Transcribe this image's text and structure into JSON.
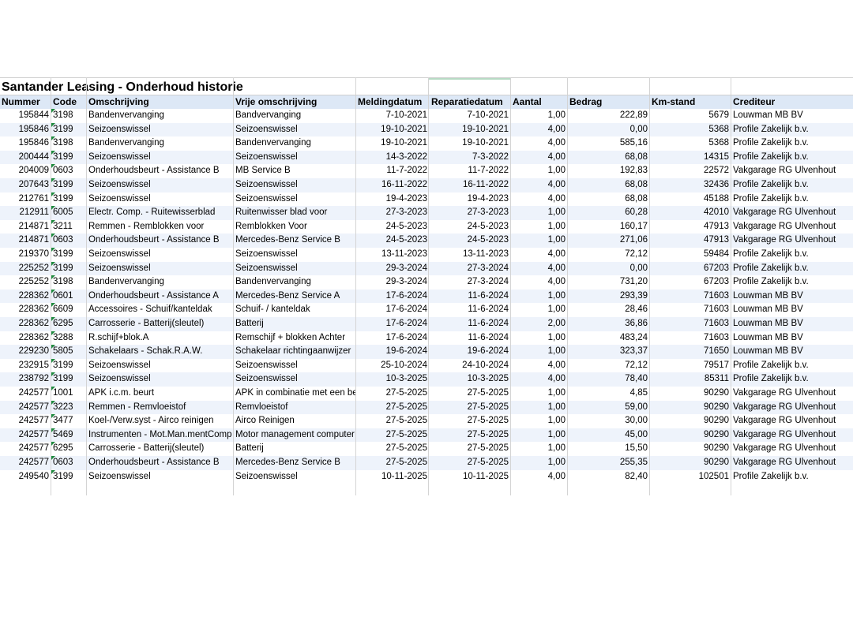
{
  "title": "Santander Leasing - Onderhoud historie",
  "columns": [
    "Nummer",
    "Code",
    "Omschrijving",
    "Vrije omschrijving",
    "Meldingdatum",
    "Reparatiedatum",
    "Aantal",
    "Bedrag",
    "Km-stand",
    "Crediteur"
  ],
  "rows": [
    [
      "195844",
      "3198",
      "Bandenvervanging",
      "Bandvervanging",
      "7-10-2021",
      "7-10-2021",
      "1,00",
      "222,89",
      "5679",
      "Louwman MB BV"
    ],
    [
      "195846",
      "3199",
      "Seizoenswissel",
      "Seizoenswissel",
      "19-10-2021",
      "19-10-2021",
      "4,00",
      "0,00",
      "5368",
      "Profile Zakelijk b.v."
    ],
    [
      "195846",
      "3198",
      "Bandenvervanging",
      "Bandenvervanging",
      "19-10-2021",
      "19-10-2021",
      "4,00",
      "585,16",
      "5368",
      "Profile Zakelijk b.v."
    ],
    [
      "200444",
      "3199",
      "Seizoenswissel",
      "Seizoenswissel",
      "14-3-2022",
      "7-3-2022",
      "4,00",
      "68,08",
      "14315",
      "Profile Zakelijk b.v."
    ],
    [
      "204009",
      "0603",
      "Onderhoudsbeurt - Assistance B",
      "MB Service B",
      "11-7-2022",
      "11-7-2022",
      "1,00",
      "192,83",
      "22572",
      "Vakgarage RG Ulvenhout"
    ],
    [
      "207643",
      "3199",
      "Seizoenswissel",
      "Seizoenswissel",
      "16-11-2022",
      "16-11-2022",
      "4,00",
      "68,08",
      "32436",
      "Profile Zakelijk b.v."
    ],
    [
      "212761",
      "3199",
      "Seizoenswissel",
      "Seizoenswissel",
      "19-4-2023",
      "19-4-2023",
      "4,00",
      "68,08",
      "45188",
      "Profile Zakelijk b.v."
    ],
    [
      "212911",
      "6005",
      "Electr. Comp. - Ruitewisserblad",
      "Ruitenwisser blad voor",
      "27-3-2023",
      "27-3-2023",
      "1,00",
      "60,28",
      "42010",
      "Vakgarage RG Ulvenhout"
    ],
    [
      "214871",
      "3211",
      "Remmen - Remblokken voor",
      "Remblokken Voor",
      "24-5-2023",
      "24-5-2023",
      "1,00",
      "160,17",
      "47913",
      "Vakgarage RG Ulvenhout"
    ],
    [
      "214871",
      "0603",
      "Onderhoudsbeurt - Assistance B",
      "Mercedes-Benz Service B",
      "24-5-2023",
      "24-5-2023",
      "1,00",
      "271,06",
      "47913",
      "Vakgarage RG Ulvenhout"
    ],
    [
      "219370",
      "3199",
      "Seizoenswissel",
      "Seizoenswissel",
      "13-11-2023",
      "13-11-2023",
      "4,00",
      "72,12",
      "59484",
      "Profile Zakelijk b.v."
    ],
    [
      "225252",
      "3199",
      "Seizoenswissel",
      "Seizoenswissel",
      "29-3-2024",
      "27-3-2024",
      "4,00",
      "0,00",
      "67203",
      "Profile Zakelijk b.v."
    ],
    [
      "225252",
      "3198",
      "Bandenvervanging",
      "Bandenvervanging",
      "29-3-2024",
      "27-3-2024",
      "4,00",
      "731,20",
      "67203",
      "Profile Zakelijk b.v."
    ],
    [
      "228362",
      "0601",
      "Onderhoudsbeurt - Assistance A",
      "Mercedes-Benz Service A",
      "17-6-2024",
      "11-6-2024",
      "1,00",
      "293,39",
      "71603",
      "Louwman MB BV"
    ],
    [
      "228362",
      "6609",
      "Accessoires - Schuif/kanteldak",
      "Schuif- / kanteldak",
      "17-6-2024",
      "11-6-2024",
      "1,00",
      "28,46",
      "71603",
      "Louwman MB BV"
    ],
    [
      "228362",
      "6295",
      "Carrosserie - Batterij(sleutel)",
      "Batterij",
      "17-6-2024",
      "11-6-2024",
      "2,00",
      "36,86",
      "71603",
      "Louwman MB BV"
    ],
    [
      "228362",
      "3288",
      "R.schijf+blok.A",
      "Remschijf + blokken Achter",
      "17-6-2024",
      "11-6-2024",
      "1,00",
      "483,24",
      "71603",
      "Louwman MB BV"
    ],
    [
      "229230",
      "5805",
      "Schakelaars - Schak.R.A.W.",
      "Schakelaar richtingaanwijzer",
      "19-6-2024",
      "19-6-2024",
      "1,00",
      "323,37",
      "71650",
      "Louwman MB BV"
    ],
    [
      "232915",
      "3199",
      "Seizoenswissel",
      "Seizoenswissel",
      "25-10-2024",
      "24-10-2024",
      "4,00",
      "72,12",
      "79517",
      "Profile Zakelijk b.v."
    ],
    [
      "238792",
      "3199",
      "Seizoenswissel",
      "Seizoenswissel",
      "10-3-2025",
      "10-3-2025",
      "4,00",
      "78,40",
      "85311",
      "Profile Zakelijk b.v."
    ],
    [
      "242577",
      "1001",
      "APK i.c.m. beurt",
      "APK in combinatie met een beu",
      "27-5-2025",
      "27-5-2025",
      "1,00",
      "4,85",
      "90290",
      "Vakgarage RG Ulvenhout"
    ],
    [
      "242577",
      "3223",
      "Remmen - Remvloeistof",
      "Remvloeistof",
      "27-5-2025",
      "27-5-2025",
      "1,00",
      "59,00",
      "90290",
      "Vakgarage RG Ulvenhout"
    ],
    [
      "242577",
      "3477",
      "Koel-/Verw.syst - Airco reinigen",
      "Airco Reinigen",
      "27-5-2025",
      "27-5-2025",
      "1,00",
      "30,00",
      "90290",
      "Vakgarage RG Ulvenhout"
    ],
    [
      "242577",
      "5469",
      "Instrumenten - Mot.Man.mentComp",
      "Motor management computer",
      "27-5-2025",
      "27-5-2025",
      "1,00",
      "45,00",
      "90290",
      "Vakgarage RG Ulvenhout"
    ],
    [
      "242577",
      "6295",
      "Carrosserie - Batterij(sleutel)",
      "Batterij",
      "27-5-2025",
      "27-5-2025",
      "1,00",
      "15,50",
      "90290",
      "Vakgarage RG Ulvenhout"
    ],
    [
      "242577",
      "0603",
      "Onderhoudsbeurt - Assistance B",
      "Mercedes-Benz Service B",
      "27-5-2025",
      "27-5-2025",
      "1,00",
      "255,35",
      "90290",
      "Vakgarage RG Ulvenhout"
    ],
    [
      "249540",
      "3199",
      "Seizoenswissel",
      "Seizoenswissel",
      "10-11-2025",
      "10-11-2025",
      "4,00",
      "82,40",
      "102501",
      "Profile Zakelijk b.v."
    ]
  ]
}
